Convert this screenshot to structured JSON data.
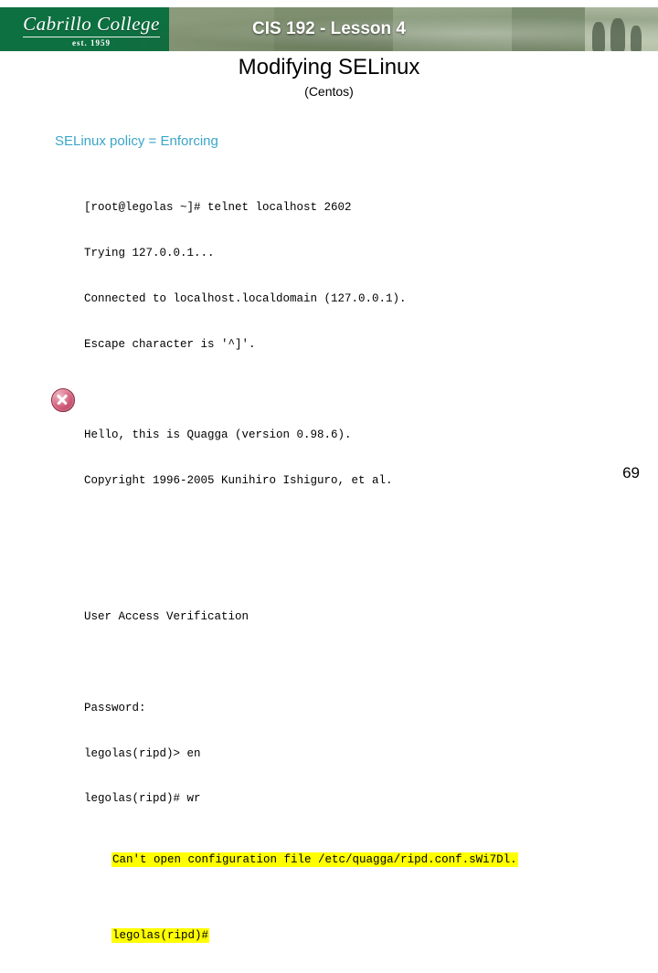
{
  "header": {
    "course_title": "CIS 192 - Lesson 4",
    "logo": {
      "name": "Cabrillo College",
      "established": "est. 1959"
    }
  },
  "slide": {
    "title": "Modifying SELinux",
    "subtitle": "(Centos)",
    "policy_line": "SELinux policy = Enforcing",
    "page_number": "69"
  },
  "terminal": {
    "lines": [
      "[root@legolas ~]# telnet localhost 2602",
      "Trying 127.0.0.1...",
      "Connected to localhost.localdomain (127.0.0.1).",
      "Escape character is '^]'.",
      "",
      "Hello, this is Quagga (version 0.98.6).",
      "Copyright 1996-2005 Kunihiro Ishiguro, et al.",
      "",
      "",
      "User Access Verification",
      "",
      "Password:",
      "legolas(ripd)> en",
      "legolas(ripd)# wr"
    ],
    "highlighted_lines": [
      "Can't open configuration file /etc/quagga/ripd.conf.sWi7Dl.",
      "legolas(ripd)#"
    ]
  },
  "colors": {
    "header_green": "#0c7040",
    "policy_text": "#3aa5c9",
    "highlight": "#ffff00"
  }
}
